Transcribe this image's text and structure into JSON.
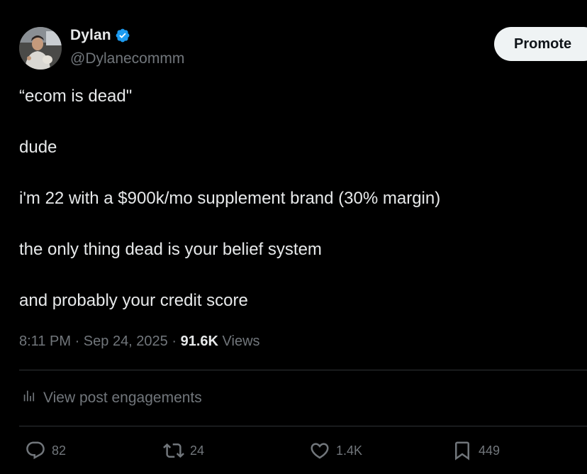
{
  "author": {
    "display_name": "Dylan",
    "handle": "@Dylanecommm",
    "verified": true,
    "verified_color": "#1d9bf0"
  },
  "header": {
    "promote_label": "Promote"
  },
  "tweet": {
    "lines": [
      "“ecom is dead\"",
      "dude",
      "i'm 22 with a $900k/mo supplement brand (30% margin)",
      "the only thing dead is your belief system",
      "and probably your credit score"
    ]
  },
  "meta": {
    "time": "8:11 PM",
    "date": "Sep 24, 2025",
    "views_count": "91.6K",
    "views_label": "Views",
    "separator": "·"
  },
  "engagements": {
    "label": "View post engagements",
    "icon": "analytics-icon"
  },
  "actions": {
    "reply": {
      "icon": "reply-icon",
      "count": "82"
    },
    "repost": {
      "icon": "repost-icon",
      "count": "24"
    },
    "like": {
      "icon": "heart-icon",
      "count": "1.4K"
    },
    "bookmark": {
      "icon": "bookmark-icon",
      "count": "449"
    }
  },
  "colors": {
    "background": "#000000",
    "text_primary": "#e7e9ea",
    "text_secondary": "#71767b",
    "divider": "#2f3336",
    "button_bg": "#eff3f4"
  }
}
